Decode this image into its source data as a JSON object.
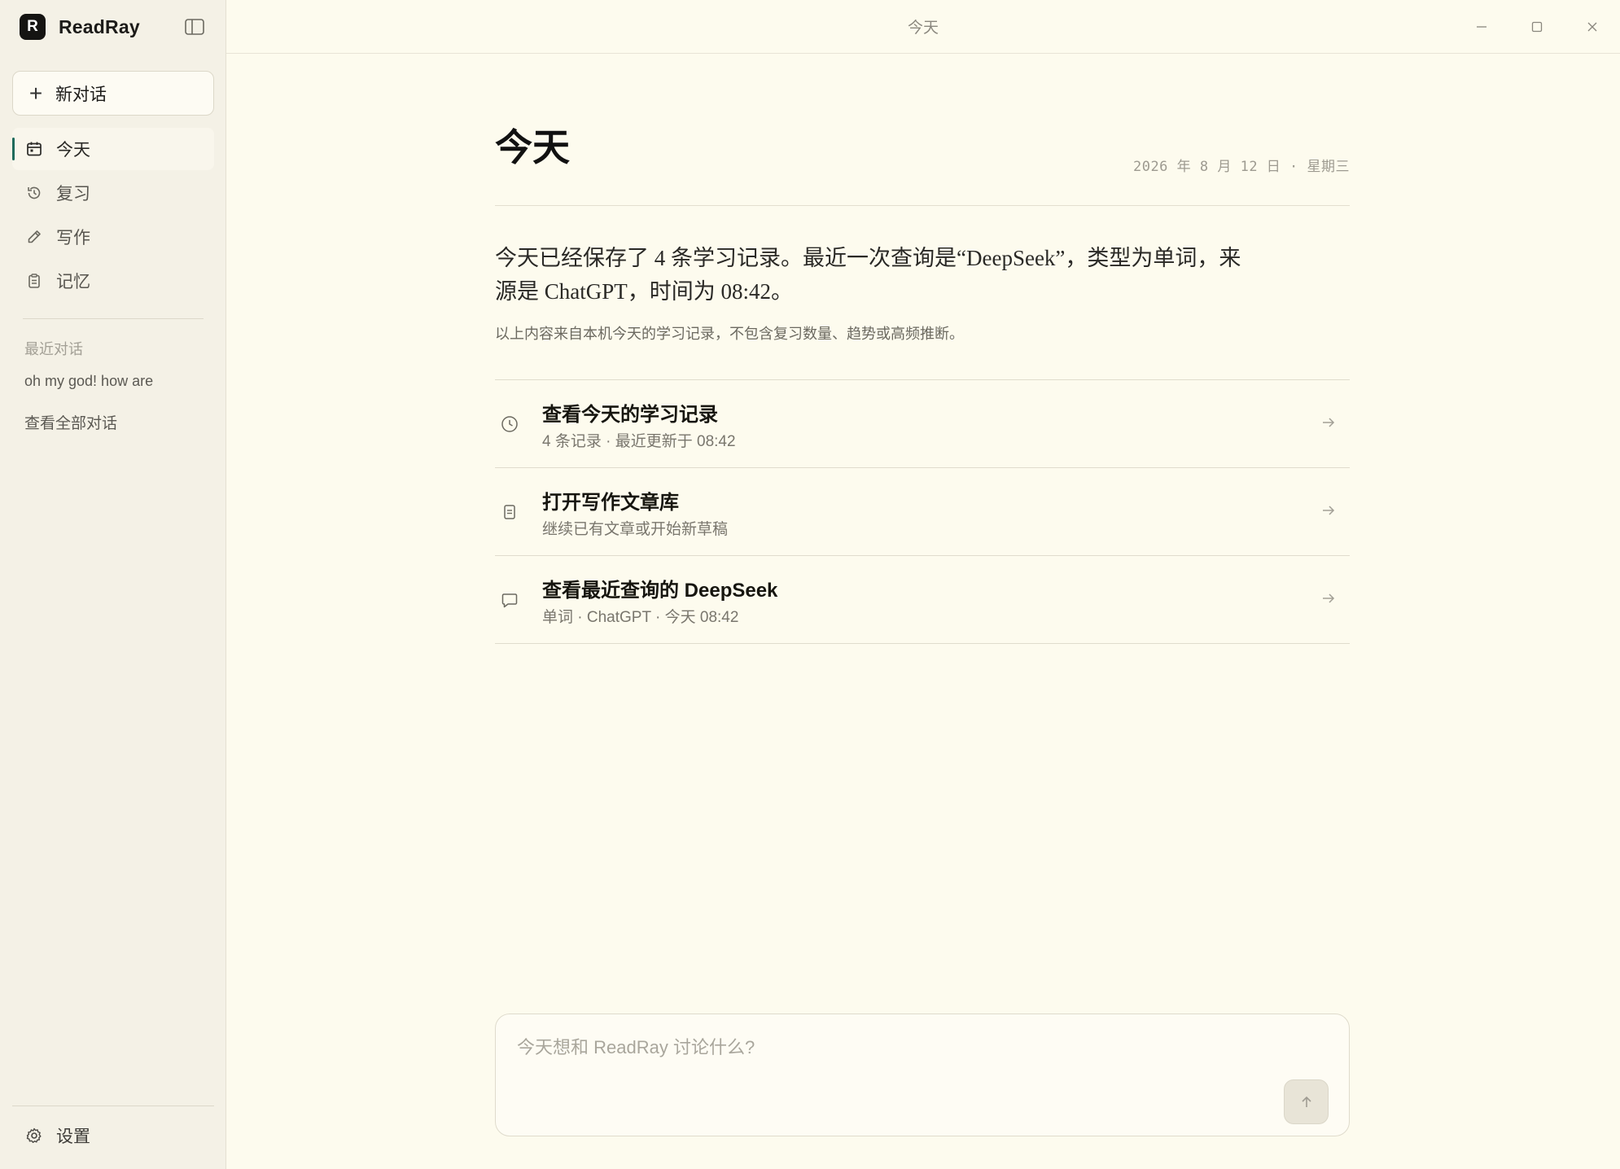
{
  "app": {
    "logo_letter": "R",
    "name": "ReadRay"
  },
  "window": {
    "title": "今天"
  },
  "sidebar": {
    "new_chat_label": "新对话",
    "nav": [
      {
        "label": "今天",
        "icon": "calendar-icon",
        "active": true
      },
      {
        "label": "复习",
        "icon": "history-icon",
        "active": false
      },
      {
        "label": "写作",
        "icon": "pencil-icon",
        "active": false
      },
      {
        "label": "记忆",
        "icon": "clipboard-icon",
        "active": false
      }
    ],
    "recent_title": "最近对话",
    "recent_items": [
      "oh my god! how are"
    ],
    "all_chats_label": "查看全部对话",
    "settings_label": "设置"
  },
  "main": {
    "page_title": "今天",
    "date": "2026 年 8 月 12 日 · 星期三",
    "summary": "今天已经保存了 4 条学习记录。最近一次查询是“DeepSeek”，类型为单词，来源是 ChatGPT，时间为 08:42。",
    "note": "以上内容来自本机今天的学习记录，不包含复习数量、趋势或高频推断。",
    "actions": [
      {
        "title": "查看今天的学习记录",
        "subtitle": "4 条记录 · 最近更新于 08:42",
        "icon": "clock-icon"
      },
      {
        "title": "打开写作文章库",
        "subtitle": "继续已有文章或开始新草稿",
        "icon": "document-icon"
      },
      {
        "title": "查看最近查询的 DeepSeek",
        "subtitle": "单词 · ChatGPT · 今天 08:42",
        "icon": "chat-bubble-icon"
      }
    ]
  },
  "composer": {
    "placeholder": "今天想和 ReadRay 讨论什么?"
  },
  "colors": {
    "accent": "#1f6b5c",
    "background": "#fdfbee",
    "sidebar": "#f4f1e6"
  }
}
